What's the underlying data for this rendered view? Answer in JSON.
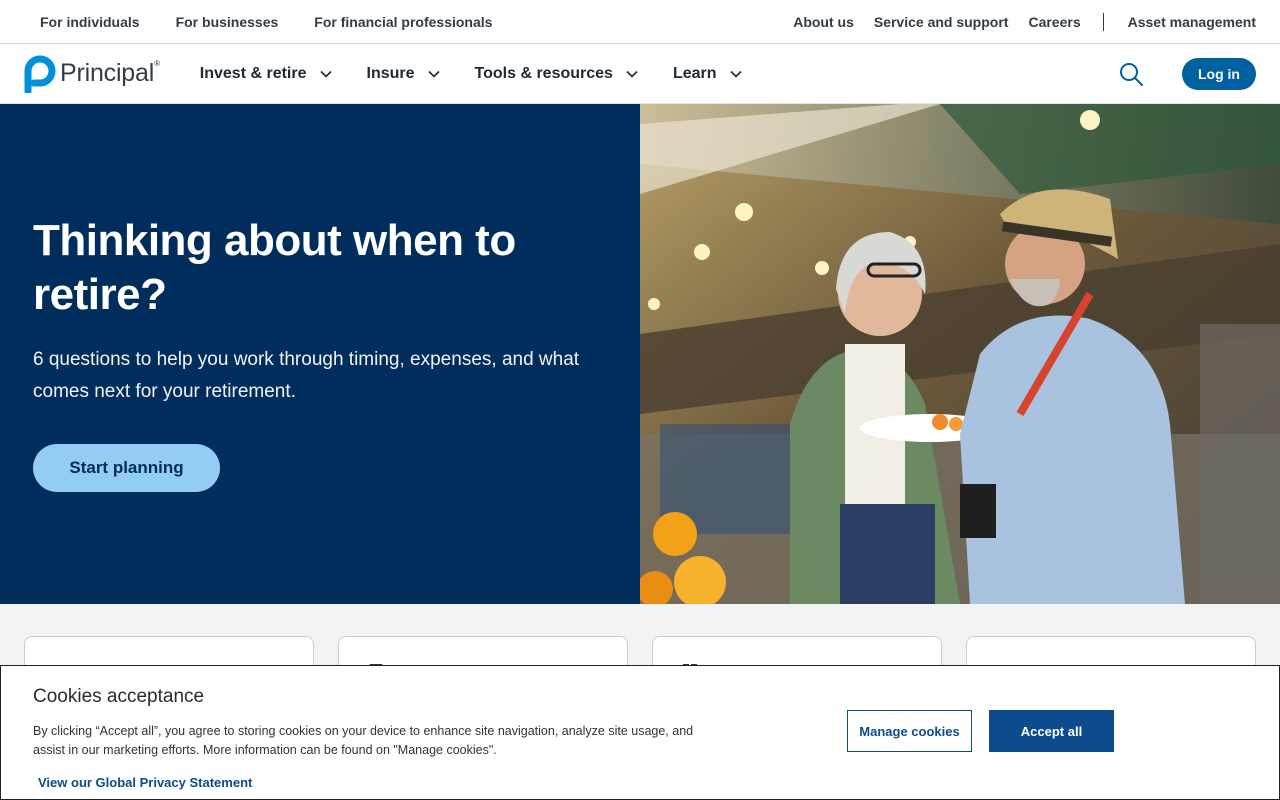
{
  "utility": {
    "left_links": [
      "For individuals",
      "For businesses",
      "For financial professionals"
    ],
    "right_links": [
      "About us",
      "Service and support",
      "Careers"
    ],
    "asset_management": "Asset management"
  },
  "nav": {
    "logo_text": "Principal",
    "logo_reg": "®",
    "items": [
      "Invest & retire",
      "Insure",
      "Tools & resources",
      "Learn"
    ],
    "login_label": "Log in"
  },
  "hero": {
    "title": "Thinking about when to retire?",
    "subtitle": "6 questions to help you work through timing, expenses, and what comes next for your retirement.",
    "cta_label": "Start planning",
    "image_alt": "Older couple smiling at a market"
  },
  "cookie": {
    "title": "Cookies acceptance",
    "text": "By clicking “Accept all”, you agree to storing cookies on your device to enhance site navigation, analyze site usage, and assist in our marketing efforts. More information can be found on \"Manage cookies\".",
    "privacy_link": "View our Global Privacy Statement",
    "manage_label": "Manage cookies",
    "accept_label": "Accept all"
  },
  "colors": {
    "brand_blue": "#0061a0",
    "hero_navy": "#002d5b",
    "cta_light_blue": "#93cdf5",
    "cookie_blue": "#0d4c8c"
  }
}
